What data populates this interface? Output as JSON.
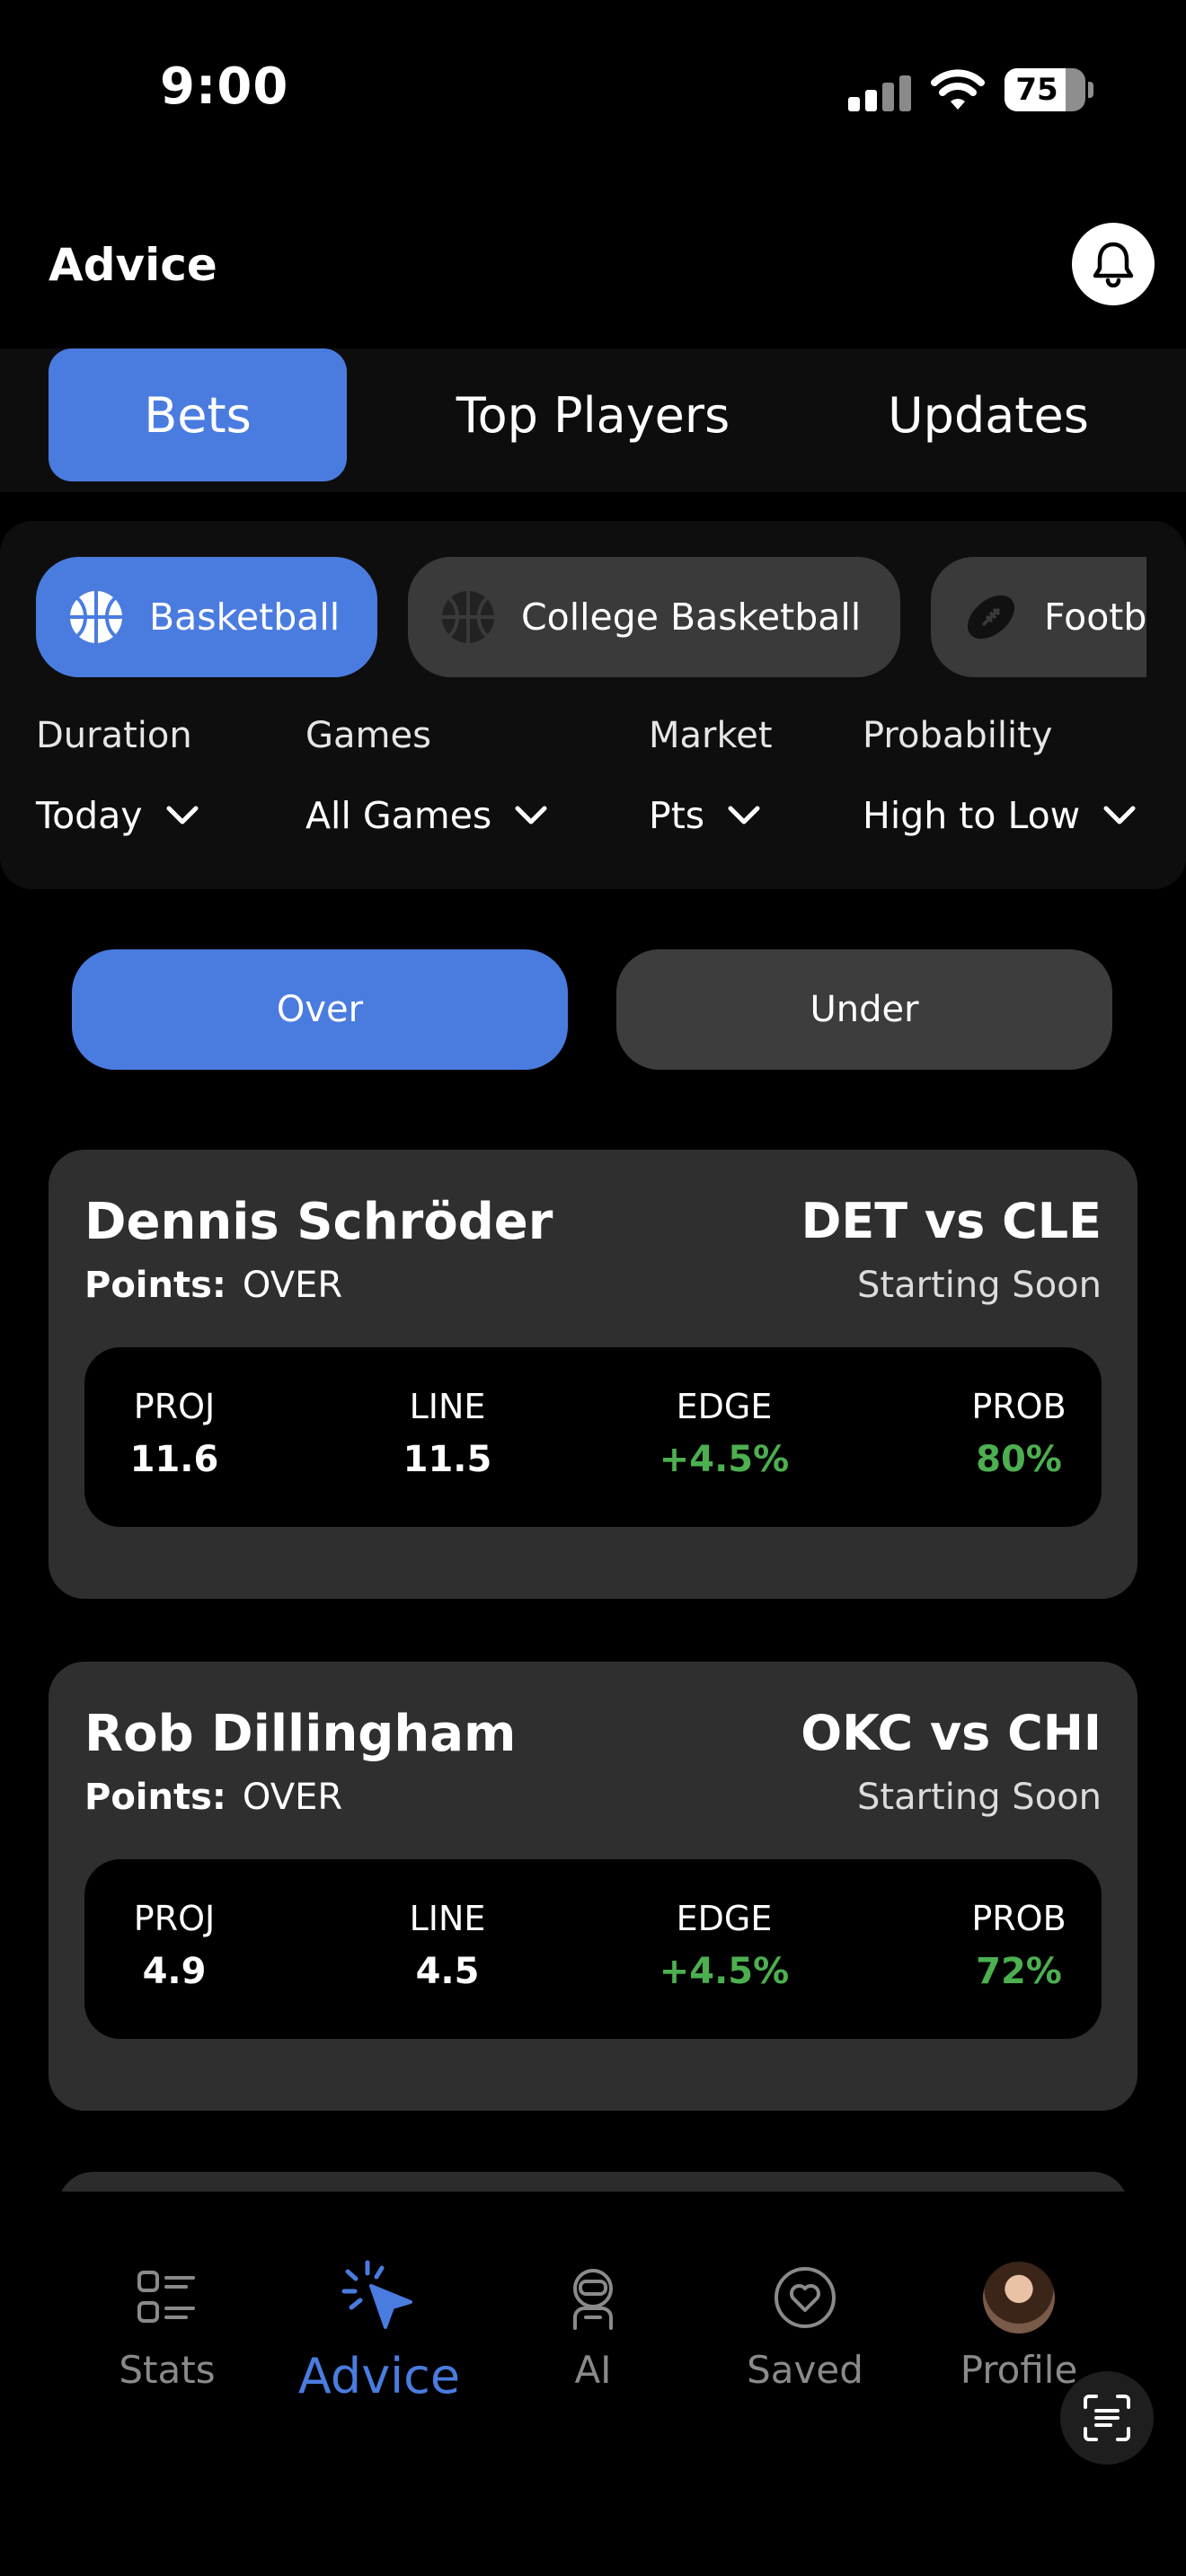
{
  "status_bar": {
    "time": "9:00",
    "battery": "75",
    "battery_level": 0.75
  },
  "header": {
    "title": "Advice"
  },
  "tabs": [
    {
      "label": "Bets",
      "active": true
    },
    {
      "label": "Top Players",
      "active": false
    },
    {
      "label": "Updates",
      "active": false
    }
  ],
  "sports": [
    {
      "label": "Basketball",
      "icon": "basketball-icon",
      "active": true
    },
    {
      "label": "College Basketball",
      "icon": "basketball-icon",
      "active": false
    },
    {
      "label": "Football",
      "icon": "football-icon",
      "active": false
    }
  ],
  "filters": {
    "duration": {
      "label": "Duration",
      "value": "Today"
    },
    "games": {
      "label": "Games",
      "value": "All Games"
    },
    "market": {
      "label": "Market",
      "value": "Pts"
    },
    "probability": {
      "label": "Probability",
      "value": "High to Low"
    }
  },
  "side_toggle": {
    "over": "Over",
    "under": "Under",
    "selected": "Over"
  },
  "stat_labels": {
    "proj": "PROJ",
    "line": "LINE",
    "edge": "EDGE",
    "prob": "PROB"
  },
  "cards": [
    {
      "player": "Dennis Schröder",
      "market_label": "Points:",
      "side": "OVER",
      "matchup": "DET vs CLE",
      "status": "Starting Soon",
      "proj": "11.6",
      "line": "11.5",
      "edge": "+4.5%",
      "prob": "80%"
    },
    {
      "player": "Rob Dillingham",
      "market_label": "Points:",
      "side": "OVER",
      "matchup": "OKC vs CHI",
      "status": "Starting Soon",
      "proj": "4.9",
      "line": "4.5",
      "edge": "+4.5%",
      "prob": "72%"
    }
  ],
  "bottom_nav": [
    {
      "label": "Stats",
      "icon": "stats-list-icon",
      "active": false
    },
    {
      "label": "Advice",
      "icon": "advice-tap-icon",
      "active": true
    },
    {
      "label": "AI",
      "icon": "robot-icon",
      "active": false
    },
    {
      "label": "Saved",
      "icon": "heart-icon",
      "active": false
    },
    {
      "label": "Profile",
      "icon": "avatar",
      "active": false
    }
  ],
  "colors": {
    "accent": "#4a7ce0",
    "positive": "#4caf50",
    "card": "#2f2f2f",
    "background": "#000000"
  }
}
